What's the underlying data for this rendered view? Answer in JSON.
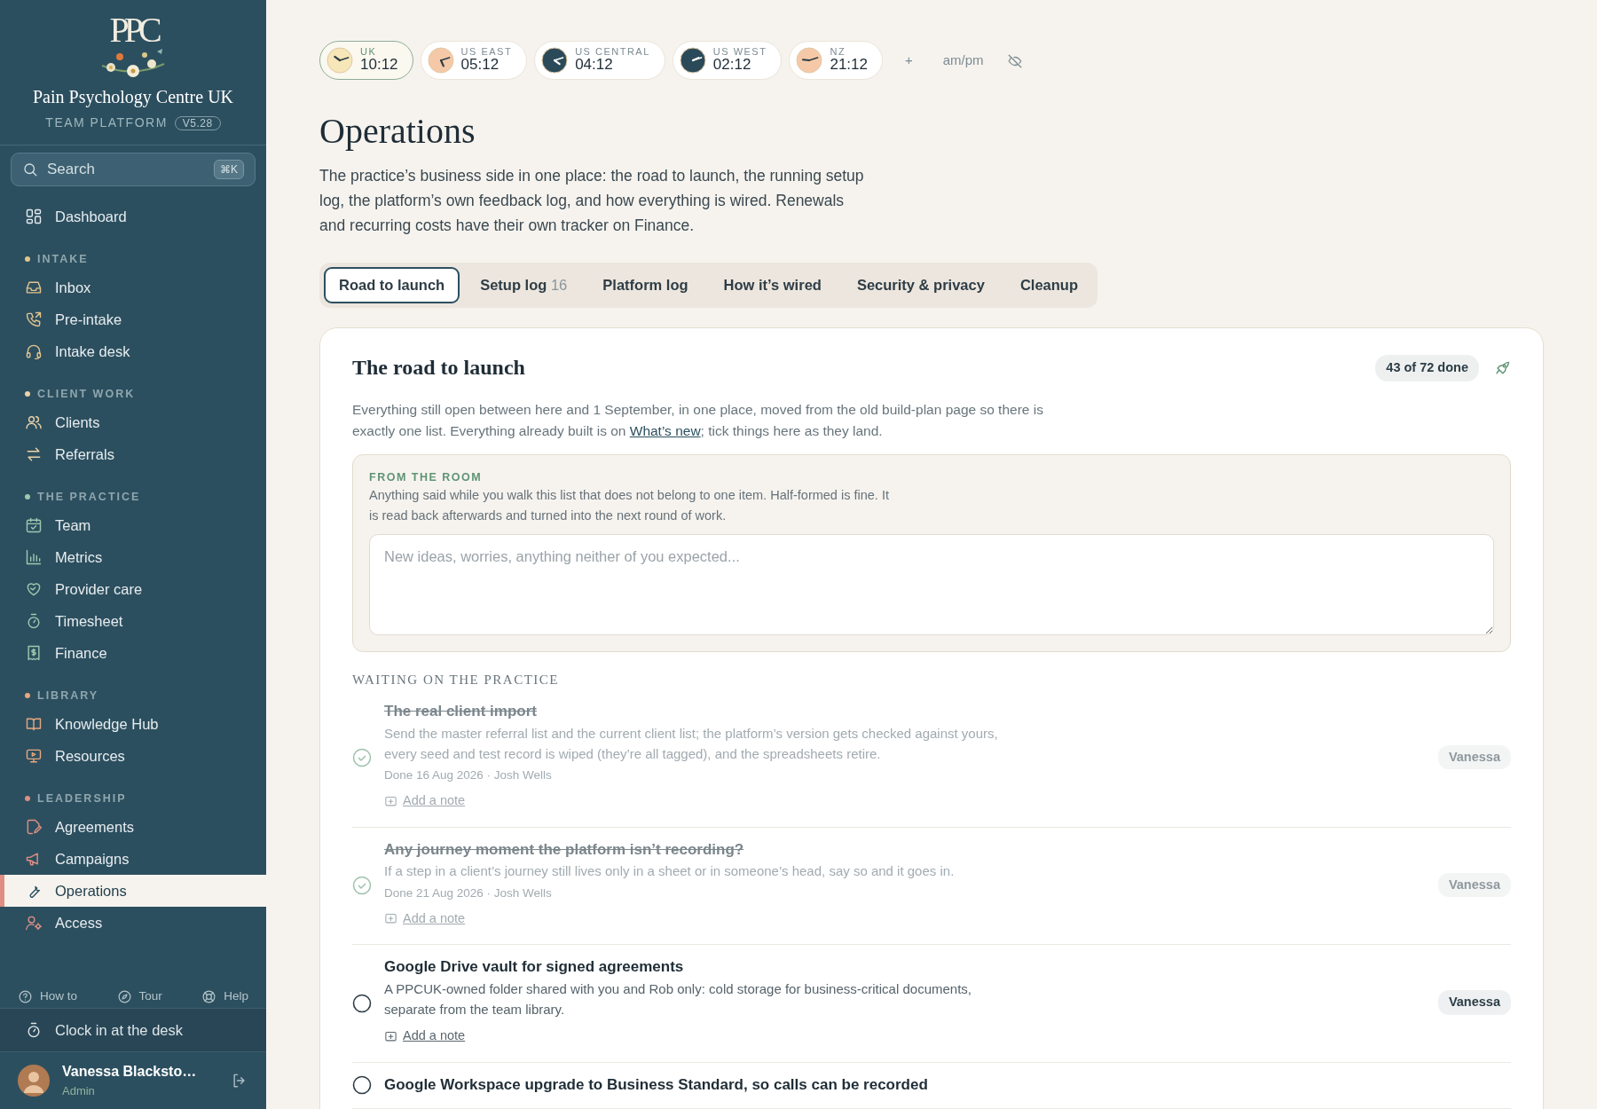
{
  "sidebar": {
    "brand": {
      "monogram": "PPC",
      "name": "Pain Psychology Centre UK",
      "subtitle": "TEAM PLATFORM",
      "version": "V5.28"
    },
    "search": {
      "placeholder": "Search",
      "shortcut": "⌘K"
    },
    "top_items": [
      {
        "label": "Dashboard",
        "selected": false
      }
    ],
    "groups": [
      {
        "label": "INTAKE",
        "color": "#e3c48f",
        "items": [
          {
            "label": "Inbox",
            "selected": false
          },
          {
            "label": "Pre-intake",
            "selected": false
          },
          {
            "label": "Intake desk",
            "selected": false
          }
        ]
      },
      {
        "label": "CLIENT WORK",
        "color": "#ecd3a8",
        "items": [
          {
            "label": "Clients",
            "selected": false
          },
          {
            "label": "Referrals",
            "selected": false
          }
        ]
      },
      {
        "label": "THE PRACTICE",
        "color": "#9cc9b0",
        "items": [
          {
            "label": "Team",
            "selected": false
          },
          {
            "label": "Metrics",
            "selected": false
          },
          {
            "label": "Provider care",
            "selected": false
          },
          {
            "label": "Timesheet",
            "selected": false
          },
          {
            "label": "Finance",
            "selected": false
          }
        ]
      },
      {
        "label": "LIBRARY",
        "color": "#e6a77e",
        "items": [
          {
            "label": "Knowledge Hub",
            "selected": false
          },
          {
            "label": "Resources",
            "selected": false
          }
        ]
      },
      {
        "label": "LEADERSHIP",
        "color": "#dd8f84",
        "items": [
          {
            "label": "Agreements",
            "selected": false
          },
          {
            "label": "Campaigns",
            "selected": false
          },
          {
            "label": "Operations",
            "selected": true
          },
          {
            "label": "Access",
            "selected": false
          }
        ]
      }
    ],
    "footer_links": [
      "How to",
      "Tour",
      "Help"
    ],
    "clock_in": "Clock in at the desk",
    "user": {
      "name": "Vanessa Blacksto…",
      "role": "Admin"
    }
  },
  "clocks": {
    "zones": [
      {
        "label": "UK",
        "time": "10:12",
        "selected": true,
        "color": "#f6e6b8"
      },
      {
        "label": "US EAST",
        "time": "05:12",
        "selected": false,
        "color": "#f5c9a8"
      },
      {
        "label": "US CENTRAL",
        "time": "04:12",
        "selected": false,
        "color": "#2b4a59"
      },
      {
        "label": "US WEST",
        "time": "02:12",
        "selected": false,
        "color": "#2b4a59"
      },
      {
        "label": "NZ",
        "time": "21:12",
        "selected": false,
        "color": "#f5c9a8"
      }
    ],
    "add": "+",
    "format": "am/pm"
  },
  "page": {
    "title": "Operations",
    "intro": "The practice’s business side in one place: the road to launch, the running setup log, the platform’s own feedback log, and how everything is wired. Renewals and recurring costs have their own tracker on Finance."
  },
  "tabs": [
    {
      "label": "Road to launch",
      "selected": true
    },
    {
      "label": "Setup log",
      "count": "16",
      "selected": false
    },
    {
      "label": "Platform log",
      "selected": false
    },
    {
      "label": "How it’s wired",
      "selected": false
    },
    {
      "label": "Security & privacy",
      "selected": false
    },
    {
      "label": "Cleanup",
      "selected": false
    }
  ],
  "card": {
    "title": "The road to launch",
    "progress": "43 of 72 done",
    "intro_start": "Everything still open between here and 1 September, in one place, moved from the old build-plan page so there is exactly one list. Everything already built is on ",
    "intro_link": "What’s new",
    "intro_end": "; tick things here as they land.",
    "room": {
      "label": "FROM THE ROOM",
      "text": "Anything said while you walk this list that does not belong to one item. Half-formed is fine. It is read back afterwards and turned into the next round of work.",
      "placeholder": "New ideas, worries, anything neither of you expected..."
    },
    "section": "WAITING ON THE PRACTICE",
    "items": [
      {
        "title": "The real client import",
        "done": true,
        "description": "Send the master referral list and the current client list; the platform’s version gets checked against yours, every seed and test record is wiped (they’re all tagged), and the spreadsheets retire.",
        "meta": "Done 16 Aug 2026 · Josh Wells",
        "note": "Add a note",
        "assignee": "Vanessa"
      },
      {
        "title": "Any journey moment the platform isn’t recording?",
        "done": true,
        "description": "If a step in a client’s journey still lives only in a sheet or in someone’s head, say so and it goes in.",
        "meta": "Done 21 Aug 2026 · Josh Wells",
        "note": "Add a note",
        "assignee": "Vanessa"
      },
      {
        "title": "Google Drive vault for signed agreements",
        "done": false,
        "description": "A PPCUK-owned folder shared with you and Rob only: cold storage for business-critical documents, separate from the team library.",
        "note": "Add a note",
        "assignee": "Vanessa"
      },
      {
        "title": "Google Workspace upgrade to Business Standard, so calls can be recorded",
        "done": false
      }
    ]
  }
}
